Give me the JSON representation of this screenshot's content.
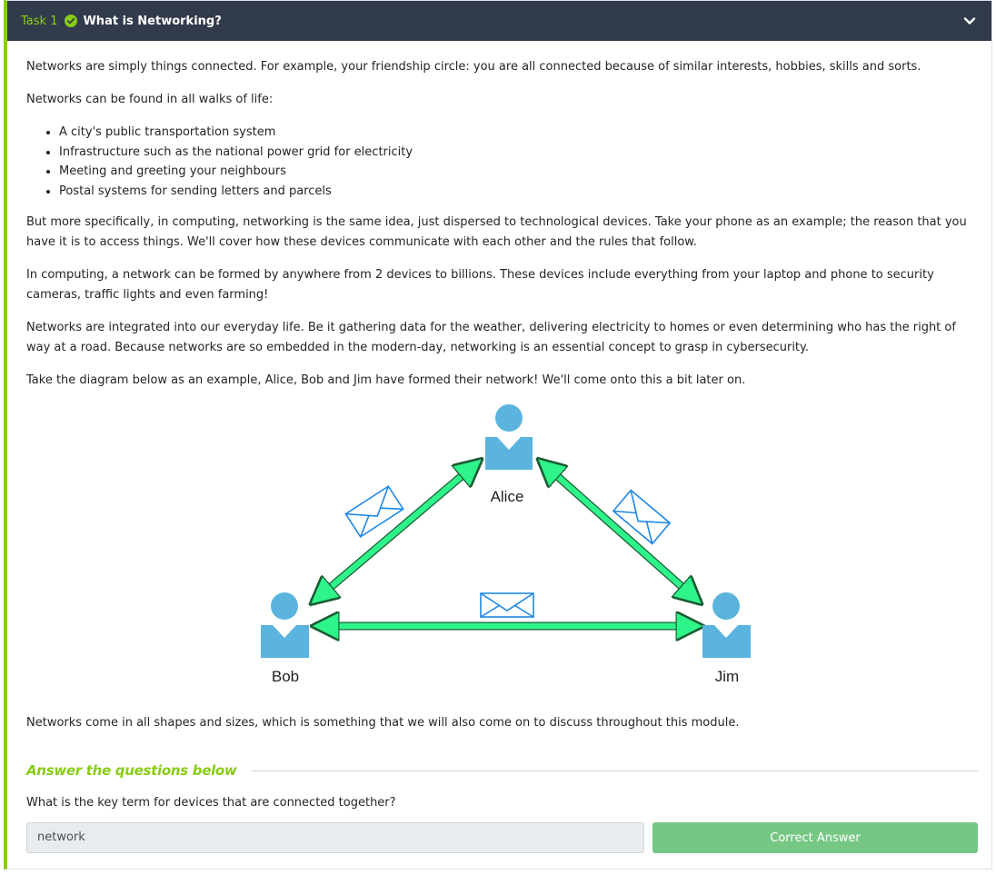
{
  "task": {
    "label": "Task 1",
    "title": "What is Networking?",
    "status": "completed"
  },
  "content": {
    "paragraph_1": "Networks are simply things connected. For example, your friendship circle: you are all connected because of similar interests, hobbies, skills and sorts.",
    "paragraph_2": "Networks can be found in all walks of life:",
    "list_items": [
      "A city's public transportation system",
      "Infrastructure such as the national power grid for electricity",
      "Meeting and greeting your neighbours",
      "Postal systems for sending letters and parcels"
    ],
    "paragraph_3": "But more specifically, in computing, networking is the same idea, just dispersed to technological devices. Take your phone as an example; the reason that you have it is to access things. We'll cover how these devices communicate with each other and the rules that follow.",
    "paragraph_4": "In computing, a network can be formed by anywhere from 2 devices to billions. These devices include everything from your laptop and phone to security cameras, traffic lights and even farming!",
    "paragraph_5": "Networks are integrated into our everyday life. Be it gathering data for the weather, delivering electricity to homes or even determining who has the right of way at a road. Because networks are so embedded in the modern-day, networking is an essential concept to grasp in cybersecurity.",
    "paragraph_6": "Take the diagram below as an example, Alice, Bob and Jim have formed their network! We'll come onto this a bit later on.",
    "closing": "Networks come in all shapes and sizes, which is something that we will also come on to discuss throughout this module."
  },
  "diagram": {
    "nodes": [
      "Alice",
      "Bob",
      "Jim"
    ],
    "colors": {
      "person": "#5ab4de",
      "arrow": "#2ef58a",
      "arrow_outline": "#1a5c34",
      "envelope": "#1e88e5"
    }
  },
  "questions": {
    "heading": "Answer the questions below",
    "items": [
      {
        "question": "What is the key term for devices that are connected together?",
        "answer": "network",
        "button_label": "Correct Answer"
      }
    ]
  },
  "colors": {
    "accent": "#88cc14",
    "header_bg": "#323b4b",
    "correct_button": "#77c784"
  }
}
